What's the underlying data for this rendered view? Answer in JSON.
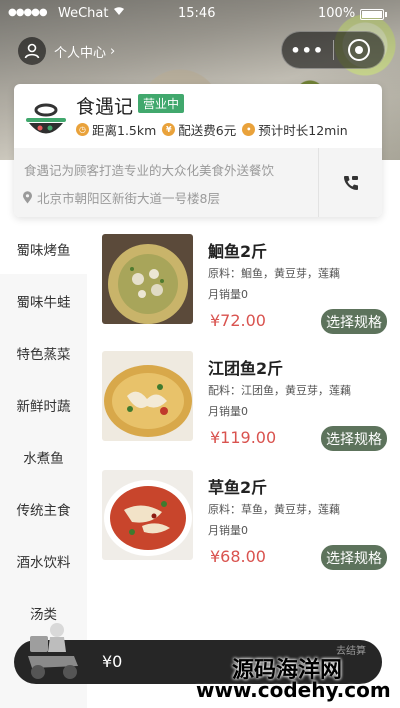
{
  "status_bar": {
    "signal": "●●●●●",
    "carrier": "WeChat",
    "time": "15:46",
    "battery": "100%"
  },
  "nav": {
    "user_center_label": "个人中心",
    "more_icon": "ellipsis-icon",
    "close_icon": "target-close-icon"
  },
  "shop": {
    "name": "食遇记",
    "status": "营业中",
    "distance": "距离1.5km",
    "delivery_fee": "配送费6元",
    "eta": "预计时长12min",
    "description": "食遇记为顾客打造专业的大众化美食外送餐饮",
    "address": "北京市朝阳区新街大道一号楼8层",
    "status_color": "#41a86d"
  },
  "categories": [
    {
      "label": "蜀味烤鱼"
    },
    {
      "label": "蜀味牛蛙"
    },
    {
      "label": "特色蒸菜"
    },
    {
      "label": "新鲜时蔬"
    },
    {
      "label": "水煮鱼"
    },
    {
      "label": "传统主食"
    },
    {
      "label": "酒水饮料"
    },
    {
      "label": "汤类"
    }
  ],
  "dishes": [
    {
      "name": "鮰鱼2斤",
      "ingredients": "原料：鮰鱼，黄豆芽，莲藕",
      "sales": "月销量0",
      "price": "¥72.00",
      "button": "选择规格"
    },
    {
      "name": "江团鱼2斤",
      "ingredients": "配料：江团鱼，黄豆芽，莲藕",
      "sales": "月销量0",
      "price": "¥119.00",
      "button": "选择规格"
    },
    {
      "name": "草鱼2斤",
      "ingredients": "原料：草鱼，黄豆芽，莲藕",
      "sales": "月销量0",
      "price": "¥68.00",
      "button": "选择规格"
    }
  ],
  "cart": {
    "total": "¥0",
    "right_text": "去结算"
  },
  "watermark": {
    "line1": "源码海洋网",
    "line2": "www.codehy.com"
  },
  "colors": {
    "accent_button": "#5d735c",
    "price": "#d9534f"
  }
}
